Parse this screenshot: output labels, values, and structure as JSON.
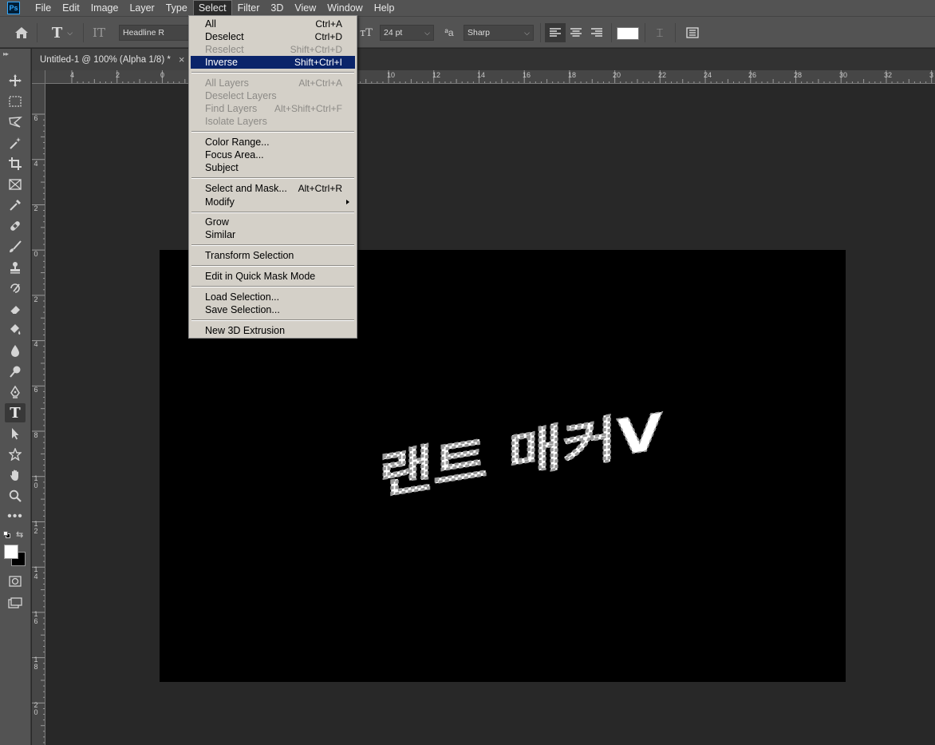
{
  "app": {
    "logo": "Ps"
  },
  "menubar": {
    "items": [
      "File",
      "Edit",
      "Image",
      "Layer",
      "Type",
      "Select",
      "Filter",
      "3D",
      "View",
      "Window",
      "Help"
    ],
    "active": "Select"
  },
  "options": {
    "font_family": "Headline R",
    "font_size": "24 pt",
    "antialias": "Sharp",
    "text_color": "#ffffff"
  },
  "document": {
    "tab_title": "Untitled-1 @ 100% (Alpha 1/8) *",
    "close_symbol": "×"
  },
  "ruler": {
    "top_labels": [
      "4",
      "2",
      "0",
      "10",
      "12",
      "14",
      "16",
      "18",
      "20",
      "22",
      "24",
      "26",
      "28",
      "30",
      "32",
      "3"
    ],
    "left_labels": [
      "6",
      "4",
      "2",
      "0",
      "2",
      "4",
      "6",
      "8",
      "10",
      "12",
      "14",
      "16",
      "18",
      "20"
    ]
  },
  "select_menu": {
    "items": [
      {
        "label": "All",
        "shortcut": "Ctrl+A",
        "state": "enabled"
      },
      {
        "label": "Deselect",
        "shortcut": "Ctrl+D",
        "state": "enabled"
      },
      {
        "label": "Reselect",
        "shortcut": "Shift+Ctrl+D",
        "state": "disabled"
      },
      {
        "label": "Inverse",
        "shortcut": "Shift+Ctrl+I",
        "state": "highlighted"
      },
      {
        "label": "All Layers",
        "shortcut": "Alt+Ctrl+A",
        "state": "disabled"
      },
      {
        "label": "Deselect Layers",
        "shortcut": "",
        "state": "disabled"
      },
      {
        "label": "Find Layers",
        "shortcut": "Alt+Shift+Ctrl+F",
        "state": "disabled"
      },
      {
        "label": "Isolate Layers",
        "shortcut": "",
        "state": "disabled"
      },
      {
        "label": "Color Range...",
        "shortcut": "",
        "state": "enabled"
      },
      {
        "label": "Focus Area...",
        "shortcut": "",
        "state": "enabled"
      },
      {
        "label": "Subject",
        "shortcut": "",
        "state": "enabled"
      },
      {
        "label": "Select and Mask...",
        "shortcut": "Alt+Ctrl+R",
        "state": "enabled"
      },
      {
        "label": "Modify",
        "shortcut": "",
        "state": "submenu"
      },
      {
        "label": "Grow",
        "shortcut": "",
        "state": "enabled"
      },
      {
        "label": "Similar",
        "shortcut": "",
        "state": "enabled"
      },
      {
        "label": "Transform Selection",
        "shortcut": "",
        "state": "enabled"
      },
      {
        "label": "Edit in Quick Mask Mode",
        "shortcut": "",
        "state": "enabled"
      },
      {
        "label": "Load Selection...",
        "shortcut": "",
        "state": "enabled"
      },
      {
        "label": "Save Selection...",
        "shortcut": "",
        "state": "enabled"
      },
      {
        "label": "New 3D Extrusion",
        "shortcut": "",
        "state": "enabled"
      }
    ]
  },
  "canvas": {
    "artwork_text": "랜트 매커V",
    "background": "#000000",
    "text_fill": "#ffffff"
  },
  "colors": {
    "foreground": "#ffffff",
    "background": "#000000",
    "menu_highlight": "#0a246a",
    "menu_bg": "#d4d0c8"
  }
}
